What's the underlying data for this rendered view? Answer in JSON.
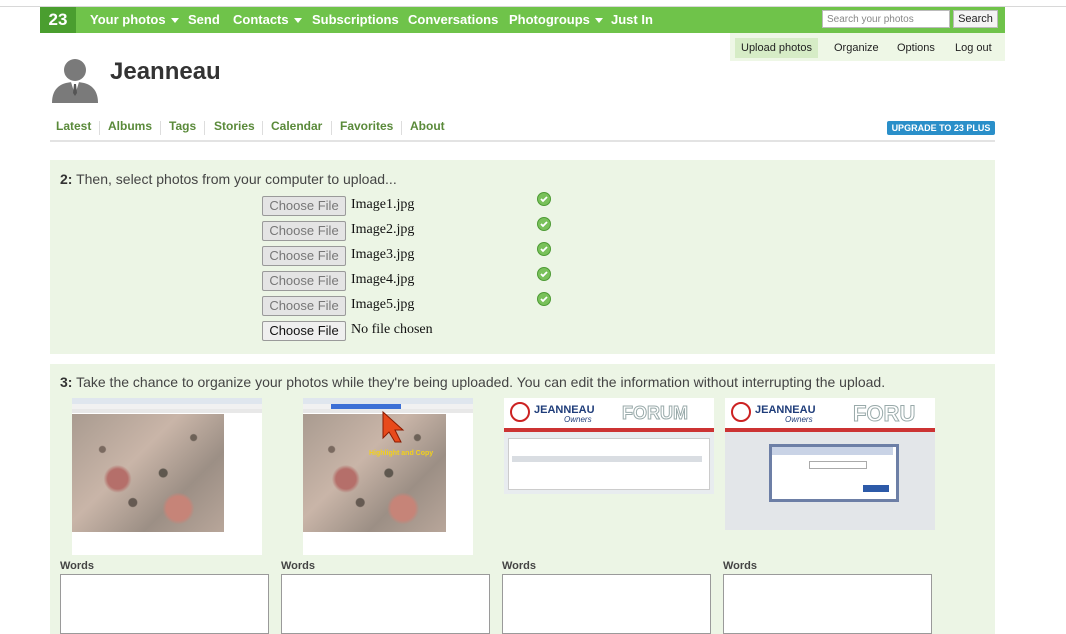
{
  "nav": {
    "logo": "23",
    "items": [
      {
        "label": "Your photos",
        "dropdown": true
      },
      {
        "label": "Send",
        "dropdown": false
      },
      {
        "label": "Contacts",
        "dropdown": true
      },
      {
        "label": "Subscriptions",
        "dropdown": false
      },
      {
        "label": "Conversations",
        "dropdown": false
      },
      {
        "label": "Photogroups",
        "dropdown": true
      },
      {
        "label": "Just In",
        "dropdown": false
      }
    ],
    "search_placeholder": "Search your photos",
    "search_button": "Search"
  },
  "subnav": {
    "items": [
      "Upload photos",
      "Organize",
      "Options",
      "Log out"
    ],
    "active": "Upload photos"
  },
  "profile": {
    "name": "Jeanneau"
  },
  "tabs": [
    "Latest",
    "Albums",
    "Tags",
    "Stories",
    "Calendar",
    "Favorites",
    "About"
  ],
  "upgrade_label": "UPGRADE TO 23 PLUS",
  "step2": {
    "number": "2:",
    "text": "Then, select photos from your computer to upload...",
    "choose_label": "Choose File",
    "files": [
      {
        "name": "Image1.jpg",
        "done": true
      },
      {
        "name": "Image2.jpg",
        "done": true
      },
      {
        "name": "Image3.jpg",
        "done": true
      },
      {
        "name": "Image4.jpg",
        "done": true
      },
      {
        "name": "Image5.jpg",
        "done": true
      },
      {
        "name": "No file chosen",
        "done": false
      }
    ]
  },
  "step3": {
    "number": "3:",
    "text": "Take the chance to organize your photos while they're being uploaded. You can edit the information without interrupting the upload.",
    "words_label": "Words",
    "thumbs": [
      {
        "kind": "aerial-photo"
      },
      {
        "kind": "aerial-photo-highlight",
        "annotation": "Highlight and Copy"
      },
      {
        "kind": "forum-screenshot",
        "brand": "JEANNEAU",
        "sub": "Owners",
        "banner": "FORUM"
      },
      {
        "kind": "forum-screenshot-dialog",
        "brand": "JEANNEAU",
        "sub": "Owners",
        "banner": "FORU"
      }
    ]
  },
  "colors": {
    "nav_green": "#6fc34a",
    "logo_green": "#4a9e2f",
    "panel_green": "#ecf5e5",
    "upgrade_blue": "#2a8fc9"
  }
}
